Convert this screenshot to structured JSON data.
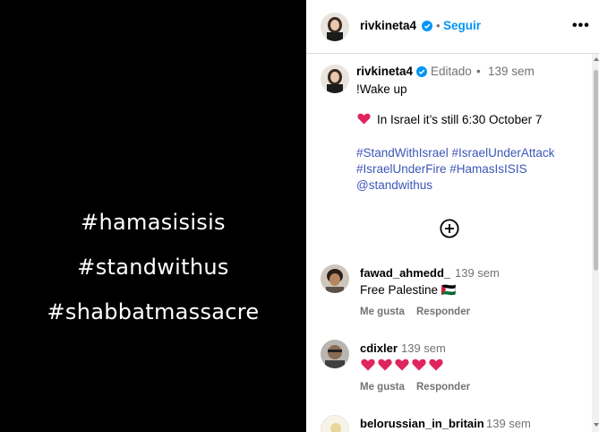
{
  "media": {
    "lines": [
      "#hamasisisis",
      "#standwithus",
      "#shabbatmassacre"
    ]
  },
  "header": {
    "username": "rivkineta4",
    "separator": "•",
    "follow_label": "Seguir",
    "more_label": "•••"
  },
  "caption": {
    "username": "rivkineta4",
    "edited": "Editado",
    "separator": "•",
    "time": "139 sem",
    "line1": "!Wake up",
    "line2": "In Israel it’s still 6:30 October 7",
    "hashtags1": "#StandWithIsrael #IsraelUnderAttack",
    "hashtags2": "#IsraelUnderFire #HamasIsISIS",
    "mention": "@standwithus"
  },
  "comments": [
    {
      "username": "fawad_ahmedd_",
      "time": "139 sem",
      "text": "Free Palestine 🇵🇸",
      "like_label": "Me gusta",
      "reply_label": "Responder"
    },
    {
      "username": "cdixler",
      "time": "139 sem",
      "hearts": 5,
      "like_label": "Me gusta",
      "reply_label": "Responder"
    },
    {
      "username": "belorussian_in_britain",
      "time": "139 sem"
    }
  ],
  "colors": {
    "link": "#3e56b8",
    "follow": "#0095f6",
    "heart": "#e0245e",
    "verified": "#0095f6"
  }
}
